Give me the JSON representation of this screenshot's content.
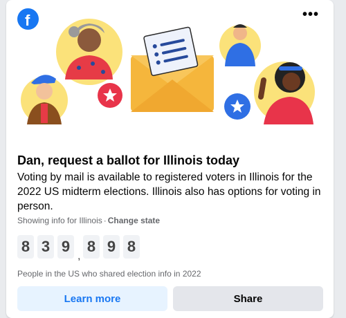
{
  "post": {
    "title": "Dan, request a ballot for Illinois today",
    "body": "Voting by mail is available to registered voters in Illinois for the 2022 US midterm elections. Illinois also has options for voting in person.",
    "state_info": "Showing info for Illinois",
    "separator": "·",
    "change_state": "Change state",
    "more_glyph": "•••",
    "brand_logo": "f"
  },
  "counter": {
    "digits": [
      "8",
      "3",
      "9",
      "8",
      "9",
      "8"
    ],
    "separator": ",",
    "label": "People in the US who shared election info in 2022"
  },
  "buttons": {
    "learn_more": "Learn more",
    "share": "Share"
  },
  "colors": {
    "brand": "#1877f2",
    "envelope": "#f5b63c",
    "badge_red": "#e8344a",
    "badge_blue": "#2f6fe4",
    "sun_yellow": "#fbe27a"
  },
  "icons": [
    "facebook-logo-icon",
    "more-options-icon",
    "ballot-envelope-icon",
    "star-badge-icon"
  ]
}
